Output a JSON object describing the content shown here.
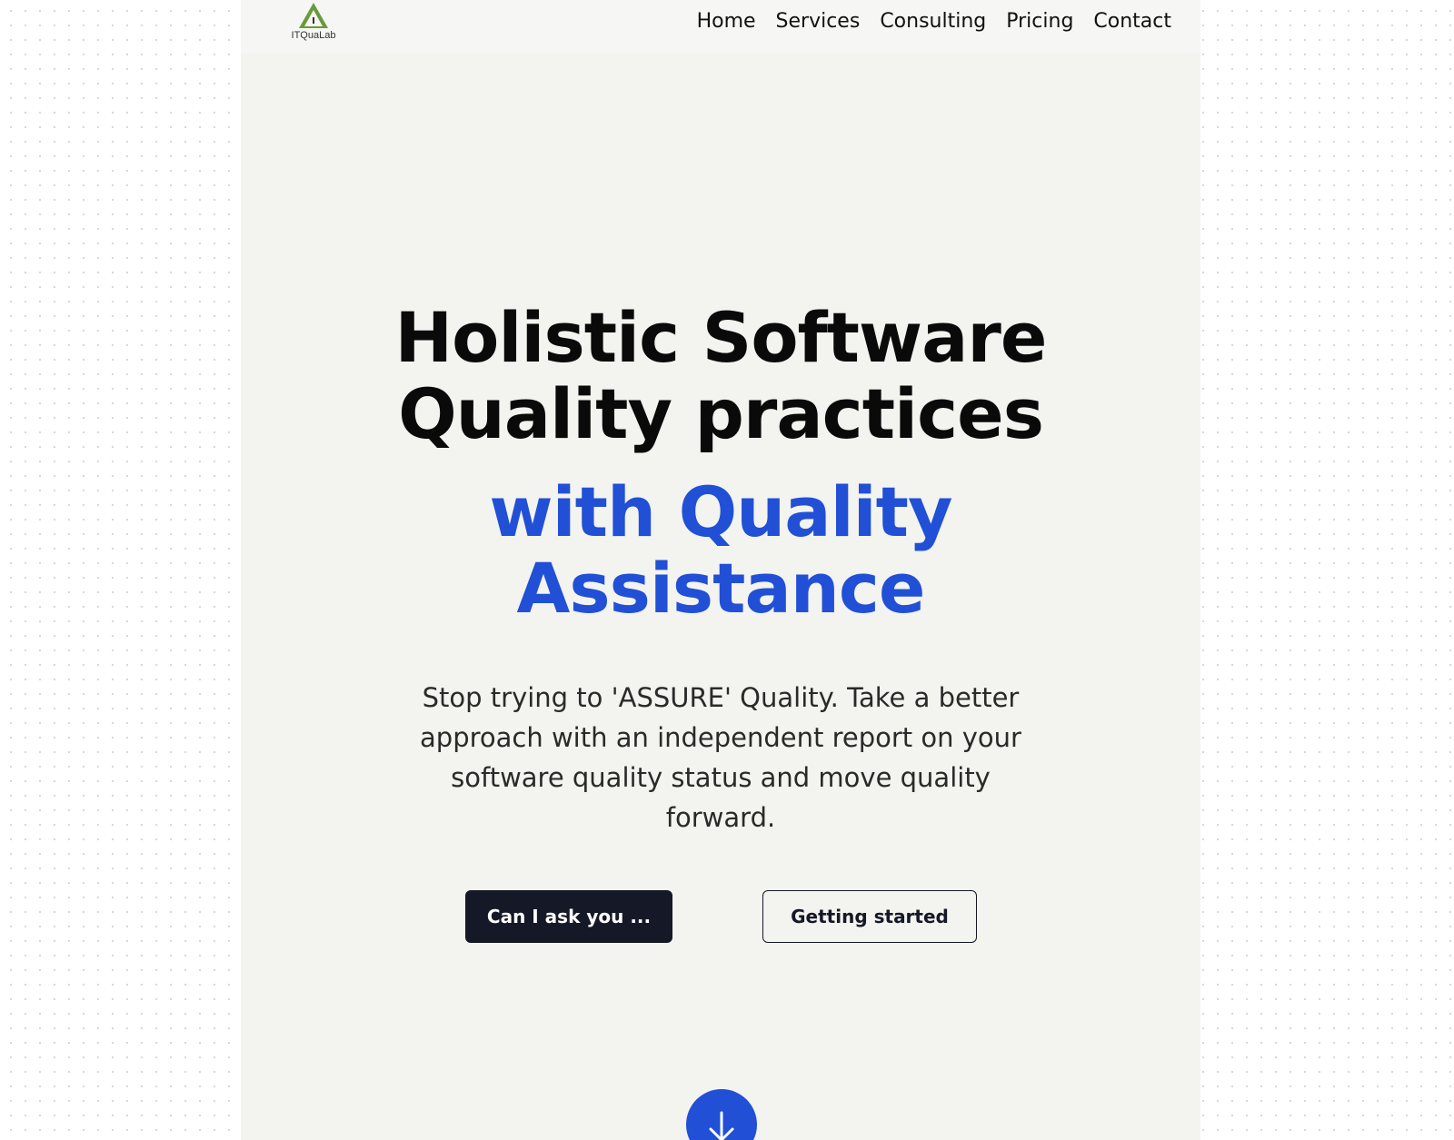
{
  "brand": {
    "logo_text": "ITQuaLab",
    "logo_color": "#6a9a3a"
  },
  "nav": {
    "items": [
      {
        "label": "Home"
      },
      {
        "label": "Services"
      },
      {
        "label": "Consulting"
      },
      {
        "label": "Pricing"
      },
      {
        "label": "Contact"
      }
    ]
  },
  "hero": {
    "headline_line1": "Holistic Software",
    "headline_line2": "Quality practices",
    "accent_line1": "with Quality",
    "accent_line2": "Assistance",
    "accent_color": "#2150d6",
    "subtitle": "Stop trying to 'ASSURE' Quality. Take a better approach with an independent report on your software quality status and move quality forward."
  },
  "actions": {
    "primary_label": "Can I ask you ...",
    "secondary_label": "Getting started",
    "scroll_icon": "arrow-down-icon"
  }
}
